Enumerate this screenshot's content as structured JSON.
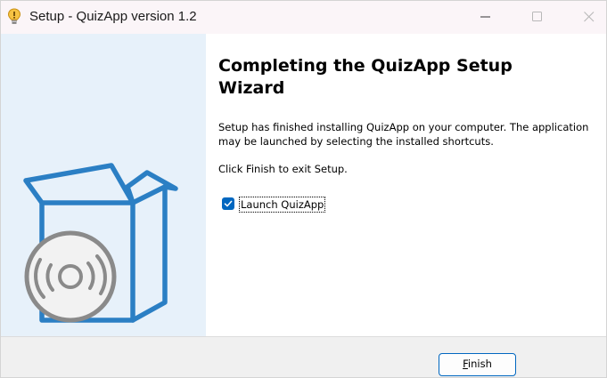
{
  "window": {
    "title": "Setup - QuizApp version 1.2"
  },
  "icons": {
    "app": "lightbulb-icon",
    "minimize": "minimize-icon",
    "maximize": "maximize-icon",
    "close": "close-icon",
    "installer_art": "software-box-disc-icon",
    "check": "checkmark-icon"
  },
  "colors": {
    "sidebar_bg": "#e7f1fa",
    "box_stroke": "#2b7fc4",
    "disc_gray": "#8a8a8a",
    "accent": "#0067c0"
  },
  "main": {
    "heading": "Completing the QuizApp Setup Wizard",
    "paragraph1": "Setup has finished installing QuizApp on your computer. The application may be launched by selecting the installed shortcuts.",
    "paragraph2": "Click Finish to exit Setup.",
    "launch_checkbox": {
      "label": "Launch QuizApp",
      "checked": true
    }
  },
  "footer": {
    "finish_prefix": "",
    "finish_accel": "F",
    "finish_rest": "inish"
  }
}
